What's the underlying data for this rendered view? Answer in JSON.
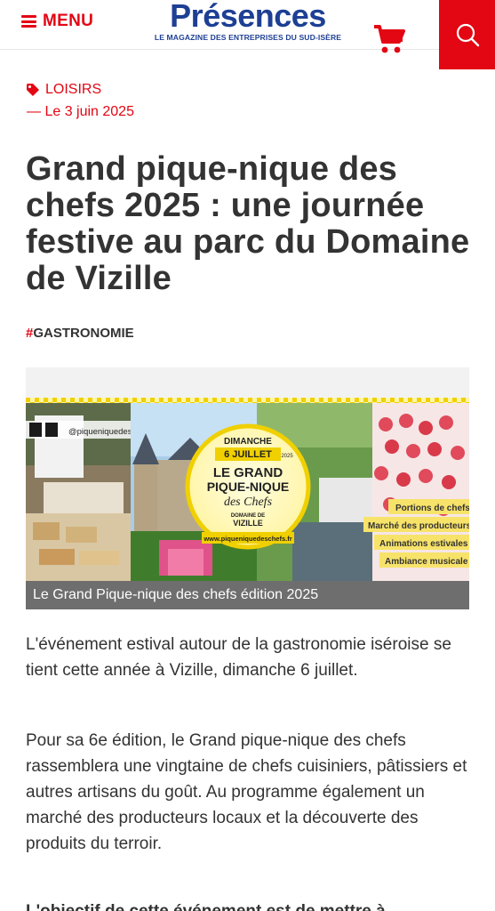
{
  "header": {
    "menu_label": "MENU",
    "logo_word": "Présences",
    "logo_tagline": "LE MAGAZINE DES ENTREPRISES DU SUD-ISÈRE",
    "brand_color": "#1d3f94",
    "accent_color": "#e30613",
    "icons": [
      "menu-icon",
      "cart-icon",
      "search-icon"
    ]
  },
  "article": {
    "category": "LOISIRS",
    "date": "— Le 3 juin 2025",
    "title": "Grand pique-nique des chefs 2025 : une journée festive au parc du Domaine de Vizille",
    "tag_hash": "#",
    "tag_text": "GASTRONOMIE",
    "image": {
      "social_handle": "@piqueniquedeschefs",
      "badge_line1": "DIMANCHE",
      "badge_line2": "6 JUILLET",
      "badge_year": "2025",
      "badge_title1": "LE GRAND",
      "badge_title2": "PIQUE-NIQUE",
      "badge_title3": "des Chefs",
      "badge_place1": "DOMAINE DE",
      "badge_place2": "VIZILLE",
      "badge_url": "www.piqueniquedeschefs.fr",
      "features": [
        "Portions de chefs",
        "Marché des producteurs",
        "Animations estivales",
        "Ambiance musicale"
      ]
    },
    "caption": "Le Grand Pique-nique des chefs édition 2025",
    "paragraphs": [
      "L'événement estival autour de la gastronomie iséroise se tient cette année à Vizille, dimanche 6 juillet.",
      "Pour sa 6e édition, le Grand pique-nique des chefs rassemblera une vingtaine de chefs cuisiniers, pâtissiers et autres artisans du goût. Au programme également un marché des producteurs locaux et la découverte des produits du terroir.",
      "L'objectif de cette événement est de mettre à"
    ]
  }
}
